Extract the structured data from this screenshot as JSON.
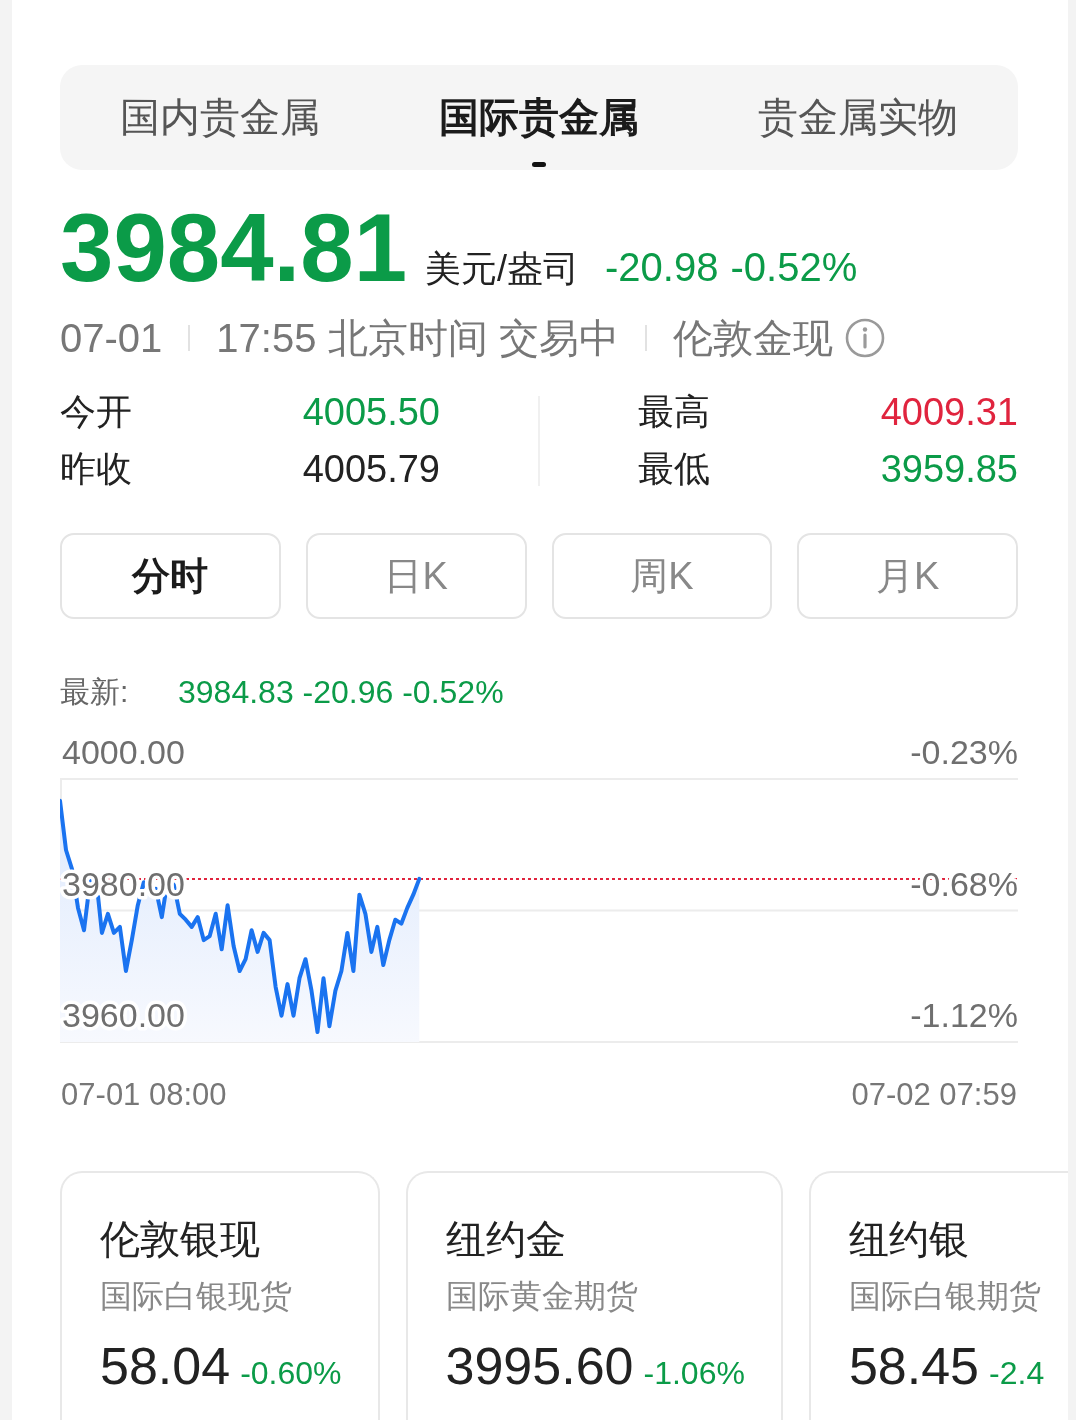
{
  "tabs": [
    {
      "label": "国内贵金属",
      "selected": false
    },
    {
      "label": "国际贵金属",
      "selected": true
    },
    {
      "label": "贵金属实物",
      "selected": false
    }
  ],
  "quote": {
    "price": "3984.81",
    "unit": "美元/盎司",
    "change": "-20.98",
    "change_percent": "-0.52%"
  },
  "status_line": {
    "date": "07-01",
    "time": "17:55 北京时间 交易中",
    "instrument": "伦敦金现"
  },
  "stats": {
    "left": [
      {
        "label": "今开",
        "value": "4005.50",
        "color": "#0b9b48"
      },
      {
        "label": "昨收",
        "value": "4005.79",
        "color": "#222222"
      }
    ],
    "right": [
      {
        "label": "最高",
        "value": "4009.31",
        "color": "#e0243e"
      },
      {
        "label": "最低",
        "value": "3959.85",
        "color": "#0b9b48"
      }
    ]
  },
  "periods": [
    {
      "label": "分时",
      "selected": true
    },
    {
      "label": "日K",
      "selected": false
    },
    {
      "label": "周K",
      "selected": false
    },
    {
      "label": "月K",
      "selected": false
    }
  ],
  "chart": {
    "latest_label": "最新:",
    "latest_value": "3984.83 -20.96 -0.52%",
    "right_axis_labels": [
      "-0.23%",
      "-0.68%",
      "-1.12%"
    ],
    "chart_data": {
      "type": "line",
      "categories": [
        null,
        null,
        null,
        null,
        null,
        null,
        null,
        null,
        null,
        null,
        null,
        null,
        null,
        null,
        "07-01 08:00",
        null,
        null,
        null,
        null,
        null,
        null,
        null,
        null,
        null,
        null,
        null,
        null,
        null,
        null,
        null,
        null,
        null,
        null,
        null,
        null,
        null,
        null,
        null,
        null,
        null,
        null,
        null,
        null,
        null,
        null,
        null,
        null,
        null,
        null,
        null,
        null,
        null,
        null,
        null,
        null,
        null,
        null,
        null,
        null,
        null,
        null,
        null,
        null,
        null,
        null,
        null,
        null,
        null,
        null,
        null,
        null,
        null,
        null,
        null,
        null,
        null,
        null,
        null,
        null,
        null,
        null,
        null,
        null,
        null,
        null,
        null,
        null,
        null,
        null,
        null,
        null,
        null,
        null,
        null,
        null,
        null,
        null,
        null,
        null,
        null,
        null,
        null,
        null,
        null,
        null,
        null,
        null,
        null,
        null,
        null,
        null,
        null,
        null,
        null,
        null,
        null,
        null,
        null,
        null,
        null,
        null,
        null,
        null,
        null,
        null,
        null,
        null,
        null,
        null,
        null,
        null,
        null,
        null,
        null,
        null,
        null,
        null,
        null,
        null,
        null,
        null,
        null,
        null,
        null,
        null,
        null,
        "07-02 07:59",
        null,
        null,
        null,
        null,
        null,
        null,
        null,
        null,
        null,
        null,
        null,
        null,
        null,
        null
      ],
      "ylim": [
        3960,
        4000
      ],
      "yticks": [
        {
          "value": 4000,
          "label": "4000.00"
        },
        {
          "value": 3980,
          "label": "3980.00"
        },
        {
          "value": 3960,
          "label": "3960.00"
        }
      ],
      "series": [
        {
          "color": "#1a73f0",
          "values": [
            3996.7,
            3989.2,
            3986.3,
            3980.4,
            3977.0,
            3984.3,
            3985.2,
            3976.6,
            3979.5,
            3976.6,
            3977.5,
            3970.8,
            3975.5,
            3980.8,
            3984.3,
            3982.8,
            3983.3,
            3979.0,
            3984.8,
            3983.9,
            3979.5,
            3978.6,
            3977.5,
            3979.0,
            3975.5,
            3976.1,
            3979.5,
            3974.1,
            3980.8,
            3974.6,
            3970.8,
            3972.6,
            3977.0,
            3973.7,
            3976.6,
            3975.5,
            3968.4,
            3964.0,
            3968.8,
            3964.0,
            3969.7,
            3972.6,
            3967.8,
            3961.5,
            3969.7,
            3962.4,
            3967.8,
            3970.8,
            3976.6,
            3970.8,
            3982.4,
            3979.5,
            3973.7,
            3977.5,
            3971.7,
            3975.5,
            3978.6,
            3978.0,
            3980.4,
            3982.4,
            3984.8,
            null,
            null,
            null,
            null,
            null,
            null,
            null,
            null,
            null,
            null,
            null,
            null,
            null,
            null,
            null,
            null,
            null,
            null,
            null,
            null,
            null,
            null,
            null,
            null,
            null,
            null,
            null,
            null,
            null,
            null,
            null,
            null,
            null,
            null,
            null,
            null,
            null,
            null,
            null,
            null,
            null,
            null,
            null,
            null,
            null,
            null,
            null,
            null,
            null,
            null,
            null,
            null,
            null,
            null,
            null,
            null,
            null,
            null,
            null,
            null,
            null,
            null,
            null,
            null,
            null,
            null,
            null,
            null,
            null,
            null,
            null,
            null,
            null,
            null,
            null,
            null,
            null,
            null,
            null,
            null,
            null,
            null,
            null,
            null,
            null,
            null,
            null,
            null,
            null,
            null,
            null,
            null,
            null,
            null,
            null,
            null,
            null,
            null,
            null,
            null
          ]
        }
      ],
      "ref_lines": [
        {
          "axis": "y",
          "value": 3984.8
        }
      ]
    }
  },
  "cards": [
    {
      "name": "伦敦银现",
      "description": "国际白银现货",
      "price": "58.04",
      "change": "-0.60%"
    },
    {
      "name": "纽约金",
      "description": "国际黄金期货",
      "price": "3995.60",
      "change": "-1.06%"
    },
    {
      "name": "纽约银",
      "description": "国际白银期货",
      "price": "58.45",
      "change": "-2.4"
    }
  ]
}
